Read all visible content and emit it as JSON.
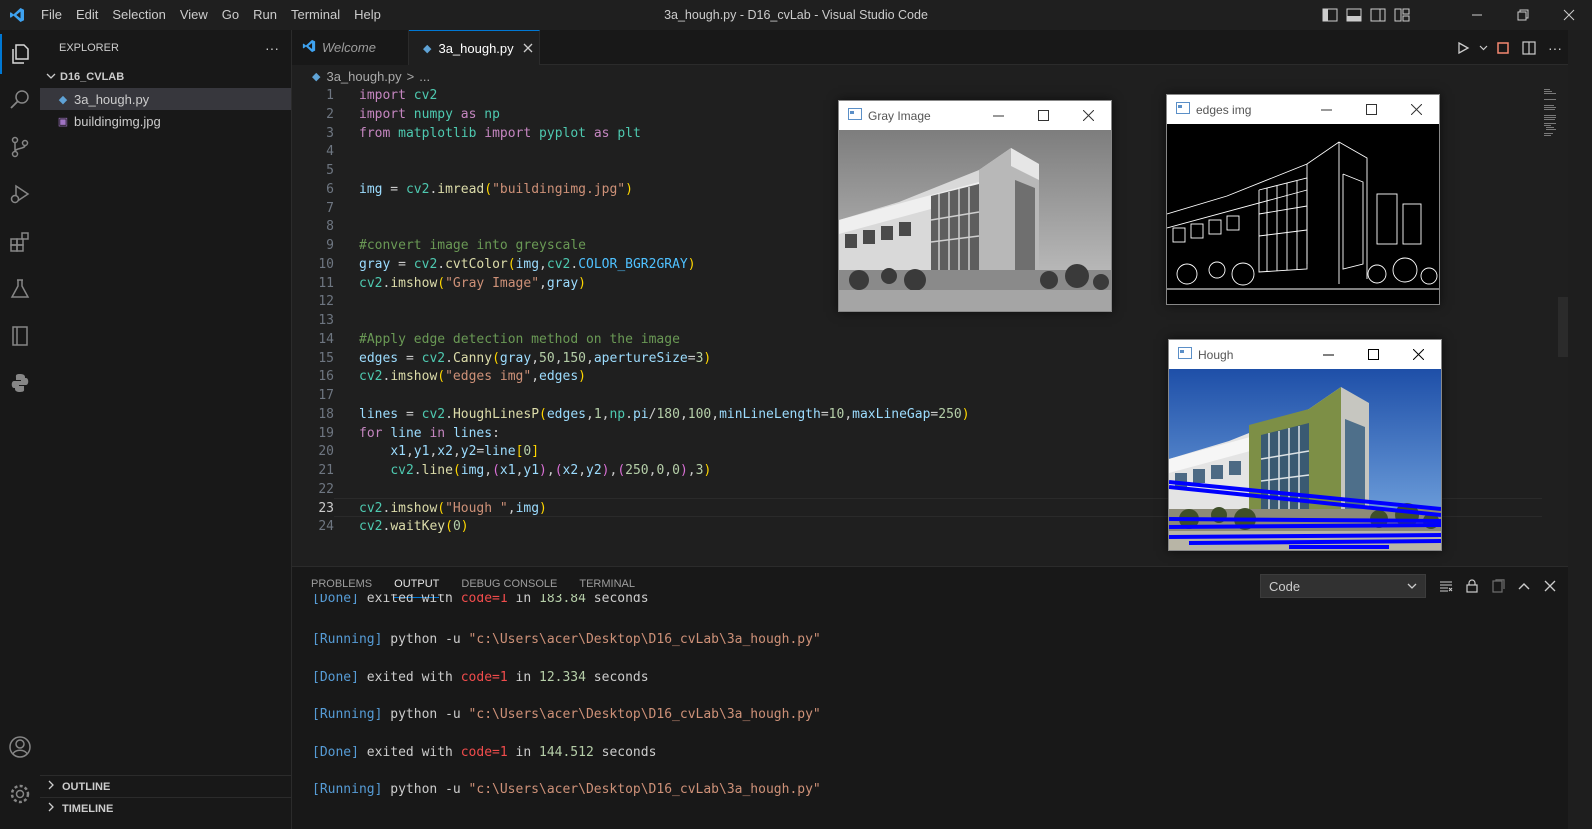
{
  "window": {
    "title": "3a_hough.py - D16_cvLab - Visual Studio Code"
  },
  "menu": [
    "File",
    "Edit",
    "Selection",
    "View",
    "Go",
    "Run",
    "Terminal",
    "Help"
  ],
  "explorer": {
    "header": "EXPLORER",
    "more": "···",
    "folder": "D16_CVLAB",
    "files": [
      {
        "name": "3a_hough.py",
        "icon": "python-file-icon"
      },
      {
        "name": "buildingimg.jpg",
        "icon": "image-file-icon"
      }
    ],
    "outline": "OUTLINE",
    "timeline": "TIMELINE"
  },
  "tabs": [
    {
      "label": "Welcome"
    },
    {
      "label": "3a_hough.py"
    }
  ],
  "breadcrumb": {
    "file": "3a_hough.py",
    "sep": ">",
    "rest": "..."
  },
  "editor": {
    "current_line": 23,
    "line_numbers": [
      "1",
      "2",
      "3",
      "4",
      "5",
      "6",
      "7",
      "8",
      "9",
      "10",
      "11",
      "12",
      "13",
      "14",
      "15",
      "16",
      "17",
      "18",
      "19",
      "20",
      "21",
      "22",
      "23",
      "24"
    ]
  },
  "panel": {
    "tabs": [
      "PROBLEMS",
      "OUTPUT",
      "DEBUG CONSOLE",
      "TERMINAL"
    ],
    "active_tab": "OUTPUT",
    "channel": "Code",
    "output": {
      "l0": {
        "tag": "[Done]",
        "text": " exited with ",
        "code": "code=1",
        "in": " in ",
        "time": "183.84",
        "unit": " seconds"
      },
      "l1": {
        "tag": "[Running]",
        "text": " python -u ",
        "path": "\"c:\\Users\\acer\\Desktop\\D16_cvLab\\3a_hough.py\""
      },
      "l2": {
        "tag": "[Done]",
        "text": " exited with ",
        "code": "code=1",
        "in": " in ",
        "time": "12.334",
        "unit": " seconds"
      },
      "l3": {
        "tag": "[Running]",
        "text": " python -u ",
        "path": "\"c:\\Users\\acer\\Desktop\\D16_cvLab\\3a_hough.py\""
      },
      "l4": {
        "tag": "[Done]",
        "text": " exited with ",
        "code": "code=1",
        "in": " in ",
        "time": "144.512",
        "unit": " seconds"
      },
      "l5": {
        "tag": "[Running]",
        "text": " python -u ",
        "path": "\"c:\\Users\\acer\\Desktop\\D16_cvLab\\3a_hough.py\""
      }
    }
  },
  "cv_windows": {
    "gray": {
      "title": "Gray Image"
    },
    "edges": {
      "title": "edges img"
    },
    "hough": {
      "title": "Hough"
    }
  },
  "colors": {
    "accent": "#0078d4",
    "hough_lines": "#0000ff"
  }
}
